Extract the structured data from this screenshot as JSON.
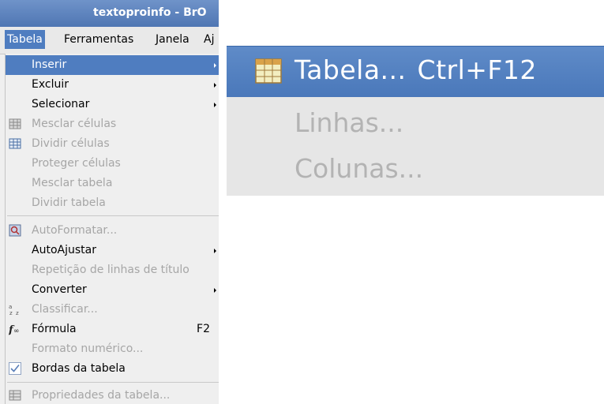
{
  "window": {
    "title": "textoproinfo - BrO"
  },
  "menubar": {
    "items": [
      "Tabela",
      "Ferramentas",
      "Janela",
      "Aj"
    ]
  },
  "menu": {
    "items": [
      {
        "label": "Inserir",
        "highlighted": true,
        "submenu": true
      },
      {
        "label": "Excluir",
        "submenu": true
      },
      {
        "label": "Selecionar",
        "submenu": true
      },
      {
        "label": "Mesclar células",
        "disabled": true,
        "icon": "merge-cells-icon"
      },
      {
        "label": "Dividir células",
        "disabled": true,
        "icon": "split-cells-icon"
      },
      {
        "label": "Proteger células",
        "disabled": true
      },
      {
        "label": "Mesclar tabela",
        "disabled": true
      },
      {
        "label": "Dividir tabela",
        "disabled": true
      },
      {
        "label": "AutoFormatar...",
        "disabled": true,
        "icon": "autoformat-icon"
      },
      {
        "label": "AutoAjustar",
        "submenu": true
      },
      {
        "label": "Repetição de linhas de título",
        "disabled": true
      },
      {
        "label": "Converter",
        "submenu": true
      },
      {
        "label": "Classificar...",
        "disabled": true,
        "icon": "sort-icon"
      },
      {
        "label": "Fórmula",
        "accelerator": "F2",
        "icon": "formula-icon"
      },
      {
        "label": "Formato numérico...",
        "disabled": true
      },
      {
        "label": "Bordas da tabela",
        "checked": true,
        "icon": "checkbox-icon"
      },
      {
        "label": "Propriedades da tabela...",
        "disabled": true,
        "icon": "table-properties-icon"
      }
    ]
  },
  "submenu_zoom": {
    "items": [
      {
        "label": "Tabela...",
        "accelerator": "Ctrl+F12",
        "highlighted": true,
        "icon": "table-icon"
      },
      {
        "label": "Linhas...",
        "disabled": true
      },
      {
        "label": "Colunas...",
        "disabled": true
      }
    ]
  },
  "colors": {
    "highlight": "#4f7dc0",
    "menu_bg": "#efefef",
    "disabled_text": "#a6a6a6"
  }
}
